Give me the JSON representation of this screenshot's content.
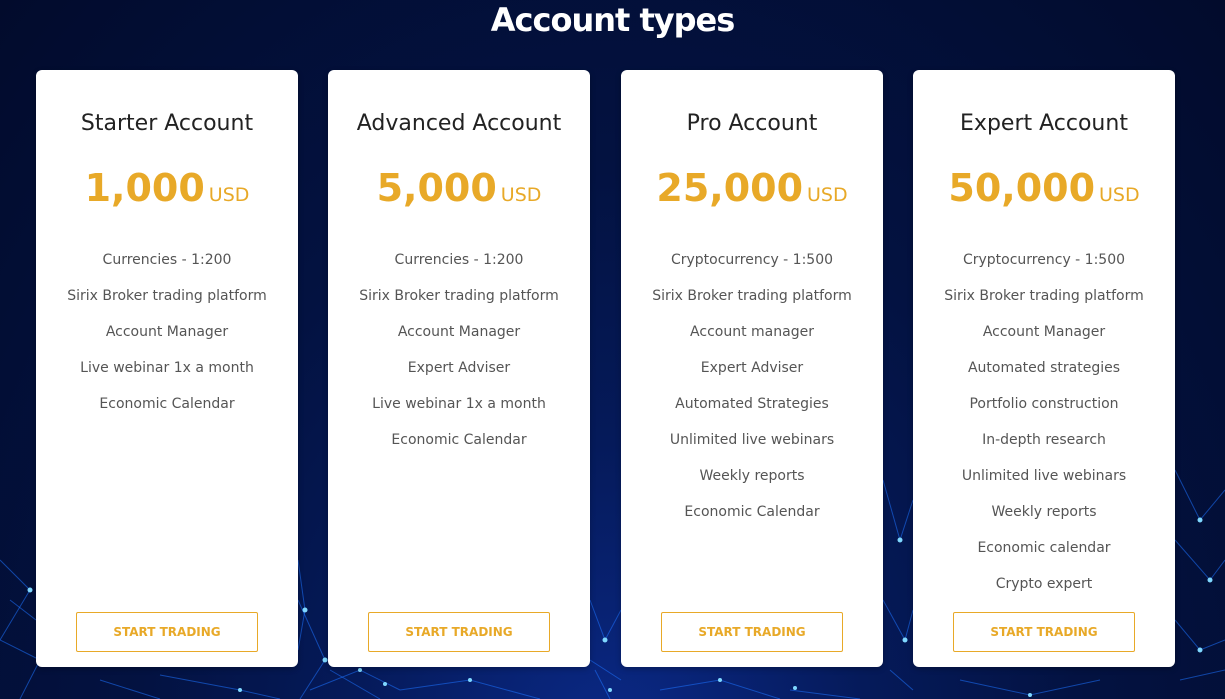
{
  "page": {
    "heading": "Account types"
  },
  "theme": {
    "accent": "#e8a928",
    "background": "#031241",
    "network_color": "#1e90ff"
  },
  "accounts": [
    {
      "title": "Starter Account",
      "amount": "1,000",
      "currency": "USD",
      "features": [
        "Currencies - 1:200",
        "Sirix Broker trading platform",
        "Account Manager",
        "Live webinar 1x a month",
        "Economic Calendar"
      ],
      "cta": "START TRADING"
    },
    {
      "title": "Advanced Account",
      "amount": "5,000",
      "currency": "USD",
      "features": [
        "Currencies - 1:200",
        "Sirix Broker trading platform",
        "Account Manager",
        "Expert Adviser",
        "Live webinar 1x a month",
        "Economic Calendar"
      ],
      "cta": "START TRADING"
    },
    {
      "title": "Pro Account",
      "amount": "25,000",
      "currency": "USD",
      "features": [
        "Cryptocurrency - 1:500",
        "Sirix Broker trading platform",
        "Account manager",
        "Expert Adviser",
        "Automated Strategies",
        "Unlimited live webinars",
        "Weekly reports",
        "Economic Calendar"
      ],
      "cta": "START TRADING"
    },
    {
      "title": "Expert Account",
      "amount": "50,000",
      "currency": "USD",
      "features": [
        "Cryptocurrency - 1:500",
        "Sirix Broker trading platform",
        "Account Manager",
        "Automated strategies",
        "Portfolio construction",
        "In-depth research",
        "Unlimited live webinars",
        "Weekly reports",
        "Economic calendar",
        "Crypto expert"
      ],
      "cta": "START TRADING"
    }
  ]
}
